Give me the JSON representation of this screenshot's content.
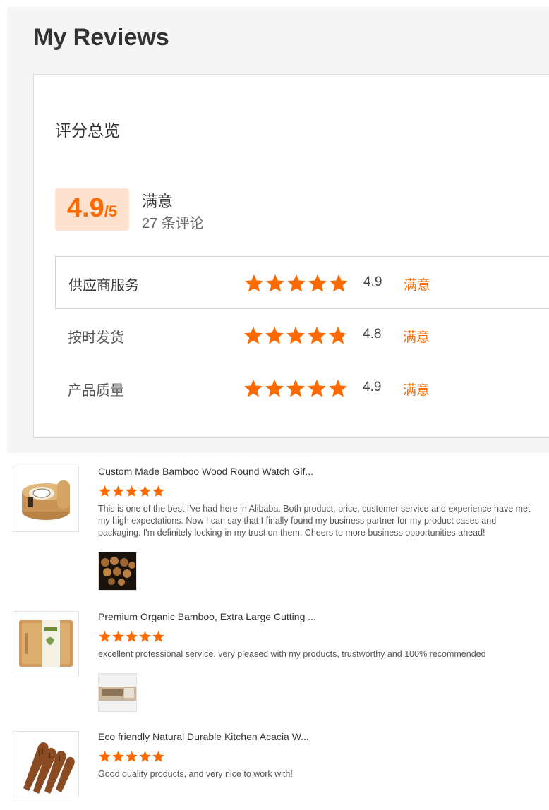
{
  "page": {
    "title": "My Reviews"
  },
  "overview": {
    "title": "评分总览",
    "score": "4.9",
    "score_denominator": "/5",
    "level": "满意",
    "count_text": "27 条评论",
    "rows": [
      {
        "name": "供应商服务",
        "value": "4.9",
        "level": "满意"
      },
      {
        "name": "按时发货",
        "value": "4.8",
        "level": "满意"
      },
      {
        "name": "产品质量",
        "value": "4.9",
        "level": "满意"
      }
    ]
  },
  "reviews": [
    {
      "product_title": "Custom Made Bamboo Wood Round Watch Gif...",
      "rating": 5,
      "text": "This is one of the best I've had here in Alibaba. Both product, price, customer service and experience have met my high expectations. Now I can say that I finally found my business partner for my product cases and packaging. I'm definitely locking-in my trust on them. Cheers to more business opportunities ahead!"
    },
    {
      "product_title": "Premium Organic Bamboo, Extra Large Cutting ...",
      "rating": 5,
      "text": "excellent professional service, very pleased with my products, trustworthy and 100% recommended"
    },
    {
      "product_title": "Eco friendly Natural Durable Kitchen Acacia W...",
      "rating": 5,
      "text": "Good quality products, and very nice to work with!"
    }
  ],
  "colors": {
    "accent": "#ff6a00",
    "score_bg": "#fde3cf"
  }
}
